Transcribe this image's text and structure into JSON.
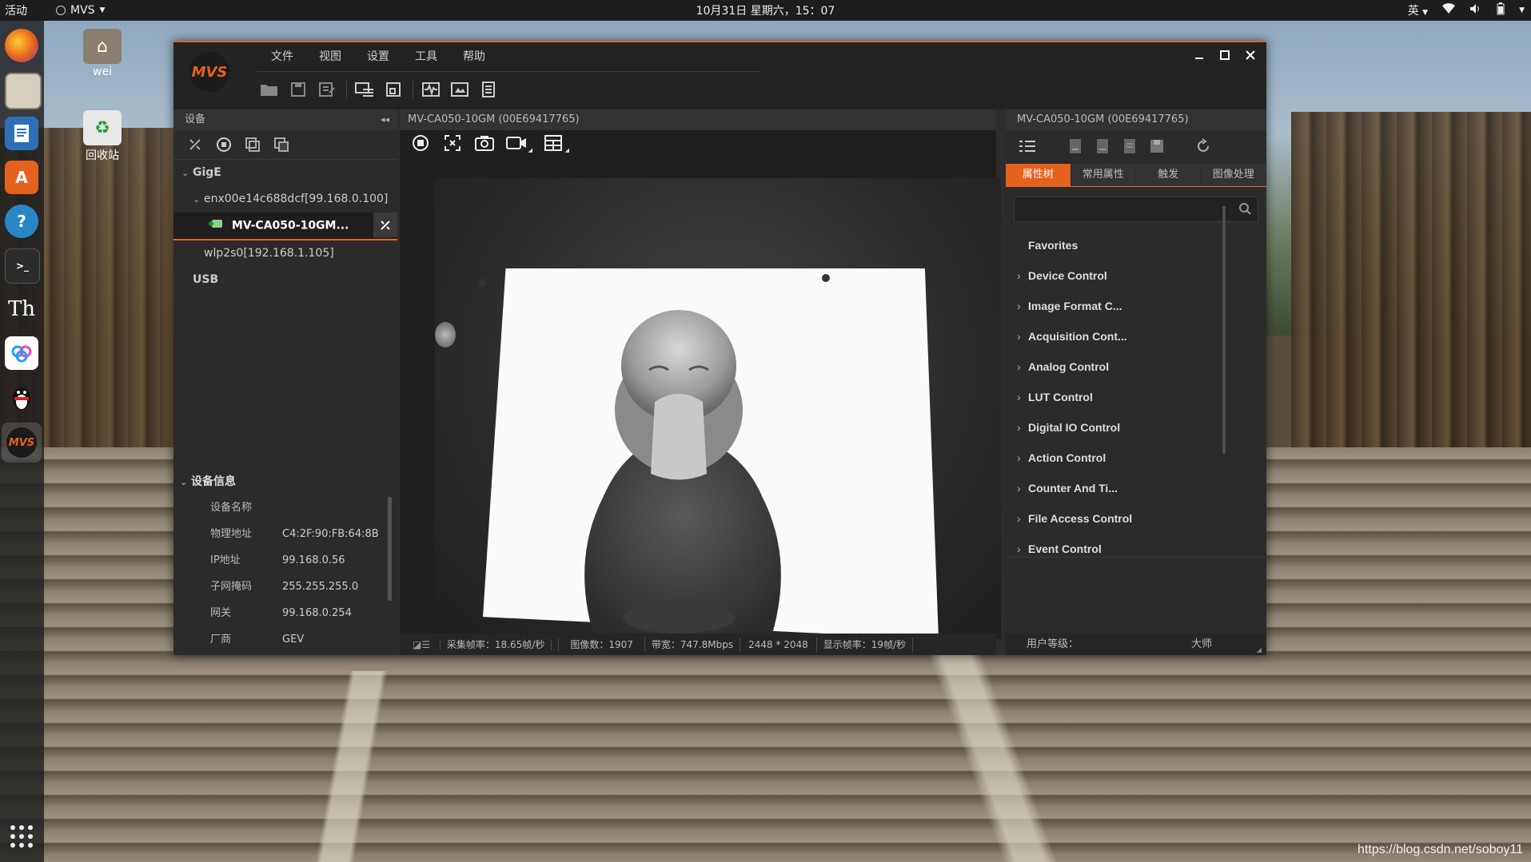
{
  "topbar": {
    "activities": "活动",
    "app_name": "MVS",
    "clock": "10月31日 星期六，15：07",
    "ime": "英"
  },
  "desktop": {
    "home_label": "wei",
    "trash_label": "回收站",
    "watermark": "https://blog.csdn.net/soboy11"
  },
  "dock": {
    "items": [
      "firefox",
      "files",
      "writer",
      "software",
      "help",
      "terminal",
      "typora",
      "baidu-netdisk",
      "qq",
      "mvs"
    ]
  },
  "window": {
    "logo_text": "MVS",
    "menu": [
      "文件",
      "视图",
      "设置",
      "工具",
      "帮助"
    ],
    "accent": "#e5611e"
  },
  "left": {
    "title": "设备",
    "tree": {
      "gige": "GigE",
      "iface": "enx00e14c688dcf[99.168.0.100]",
      "camera": "MV-CA050-10GM...",
      "wlan": "wlp2s0[192.168.1.105]",
      "usb": "USB"
    },
    "info": {
      "title": "设备信息",
      "rows": [
        {
          "k": "设备名称",
          "v": ""
        },
        {
          "k": "物理地址",
          "v": "C4:2F:90:FB:64:8B"
        },
        {
          "k": "IP地址",
          "v": "99.168.0.56"
        },
        {
          "k": "子网掩码",
          "v": "255.255.255.0"
        },
        {
          "k": "网关",
          "v": "99.168.0.254"
        },
        {
          "k": "厂商",
          "v": "GEV"
        }
      ]
    }
  },
  "center": {
    "title": "MV-CA050-10GM (00E69417765)",
    "status": {
      "fps": "采集帧率：18.65帧/秒",
      "count": "图像数：1907",
      "bandwidth": "带宽：747.8Mbps",
      "resolution": "2448 * 2048",
      "display_fps": "显示帧率：19帧/秒"
    }
  },
  "right": {
    "title": "MV-CA050-10GM (00E69417765)",
    "tabs": [
      "属性树",
      "常用属性",
      "触发",
      "图像处理"
    ],
    "search_placeholder": "",
    "favorites": "Favorites",
    "props": [
      "Device Control",
      "Image Format C...",
      "Acquisition Cont...",
      "Analog Control",
      "LUT Control",
      "Digital IO Control",
      "Action Control",
      "Counter And Ti...",
      "File Access Control",
      "Event Control"
    ],
    "user_level_label": "用户等级：",
    "user_level_value": "大师"
  }
}
